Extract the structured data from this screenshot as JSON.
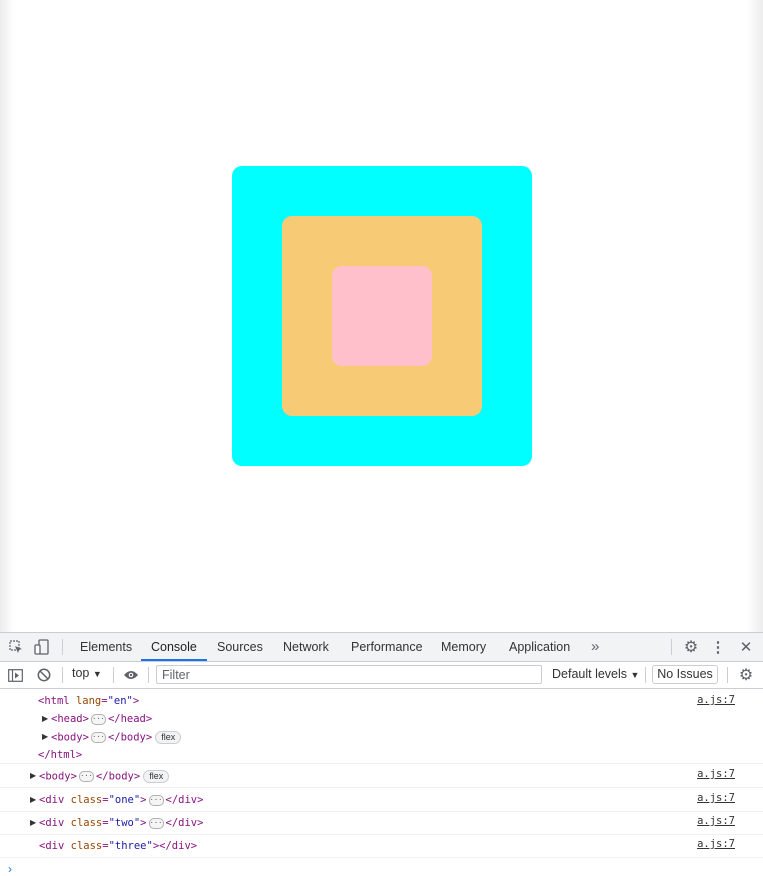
{
  "page": {
    "boxes": [
      {
        "name": "one",
        "color": "#00ffff"
      },
      {
        "name": "two",
        "color": "#f7cb76"
      },
      {
        "name": "three",
        "color": "#ffc0cb"
      }
    ]
  },
  "devtools": {
    "tabs": [
      "Elements",
      "Console",
      "Sources",
      "Network",
      "Performance",
      "Memory",
      "Application"
    ],
    "active_tab": "Console",
    "more_tabs": "»",
    "context": "top",
    "filter_placeholder": "Filter",
    "levels": "Default levels",
    "issues": "No Issues"
  },
  "console": {
    "source": "a.js:7",
    "msg1": {
      "html_open": "<html",
      "html_attr": "lang",
      "html_val": "\"en\"",
      "html_close": ">",
      "head_open": "<head>",
      "head_close": "</head>",
      "body_open": "<body>",
      "body_close": "</body>",
      "flex": "flex",
      "end": "</html>"
    },
    "msg2": {
      "open": "<body>",
      "close": "</body>",
      "flex": "flex"
    },
    "msg3": {
      "open": "<div",
      "attr": "class",
      "val": "\"one\"",
      "gt": ">",
      "close": "</div>"
    },
    "msg4": {
      "open": "<div",
      "attr": "class",
      "val": "\"two\"",
      "gt": ">",
      "close": "</div>"
    },
    "msg5": {
      "open": "<div",
      "attr": "class",
      "val": "\"three\"",
      "gt": ">",
      "close": "</div>"
    },
    "ellipsis": "···",
    "prompt": "›"
  }
}
